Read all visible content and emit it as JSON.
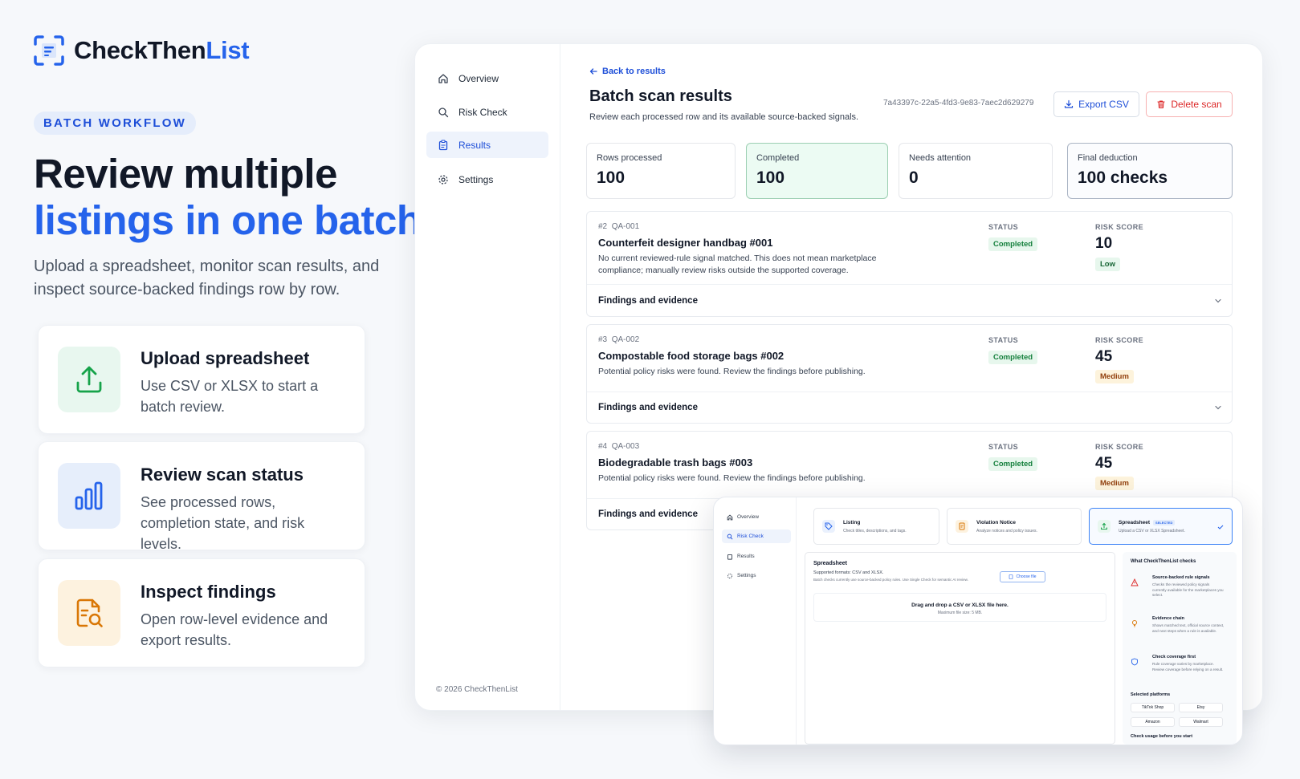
{
  "brand": {
    "name_part1": "CheckThen",
    "name_part2": "List",
    "accent": "#2563eb"
  },
  "hero": {
    "badge": "BATCH WORKFLOW",
    "title_line1": "Review multiple",
    "title_line2": "listings in one batch",
    "subtitle": "Upload a spreadsheet, monitor scan results, and inspect source-backed findings row by row."
  },
  "features": [
    {
      "title": "Upload spreadsheet",
      "desc": "Use CSV or XLSX to start a batch review.",
      "icon": "upload-icon"
    },
    {
      "title": "Review scan status",
      "desc": "See processed rows, completion state, and risk levels.",
      "icon": "bar-chart-icon"
    },
    {
      "title": "Inspect findings",
      "desc": "Open row-level evidence and export results.",
      "icon": "document-search-icon"
    }
  ],
  "app": {
    "nav": [
      {
        "label": "Overview",
        "icon": "home-icon"
      },
      {
        "label": "Risk Check",
        "icon": "search-icon"
      },
      {
        "label": "Results",
        "icon": "clipboard-icon",
        "active": true
      },
      {
        "label": "Settings",
        "icon": "gear-icon"
      }
    ],
    "footer": "© 2026 CheckThenList",
    "back_label": "Back to results",
    "page_title": "Batch scan results",
    "page_subtitle": "Review each processed row and its available source-backed signals.",
    "batch_id": "7a43397c-22a5-4fd3-9e83-7aec2d629279",
    "export_label": "Export CSV",
    "delete_label": "Delete scan",
    "stats": [
      {
        "label": "Rows processed",
        "value": "100"
      },
      {
        "label": "Completed",
        "value": "100"
      },
      {
        "label": "Needs attention",
        "value": "0"
      },
      {
        "label": "Final deduction",
        "value": "100 checks"
      }
    ],
    "status_header": "STATUS",
    "risk_header": "RISK SCORE",
    "findings_label": "Findings and evidence",
    "rows": [
      {
        "num": "#2",
        "code": "QA-001",
        "title": "Counterfeit designer handbag #001",
        "desc": "No current reviewed-rule signal matched. This does not mean marketplace compliance; manually review risks outside the supported coverage.",
        "status": "Completed",
        "score": "10",
        "level": "Low"
      },
      {
        "num": "#3",
        "code": "QA-002",
        "title": "Compostable food storage bags #002",
        "desc": "Potential policy risks were found. Review the findings before publishing.",
        "status": "Completed",
        "score": "45",
        "level": "Medium"
      },
      {
        "num": "#4",
        "code": "QA-003",
        "title": "Biodegradable trash bags #003",
        "desc": "Potential policy risks were found. Review the findings before publishing.",
        "status": "Completed",
        "score": "45",
        "level": "Medium"
      }
    ]
  },
  "overlay": {
    "nav": [
      "Overview",
      "Risk Check",
      "Results",
      "Settings"
    ],
    "modes": [
      {
        "title": "Listing",
        "desc": "Check titles, descriptions, and tags."
      },
      {
        "title": "Violation Notice",
        "desc": "Analyze notices and policy issues."
      },
      {
        "title": "Spreadsheet",
        "desc": "Upload a CSV or XLSX Spreadsheet.",
        "badge": "SELECTED"
      }
    ],
    "upload": {
      "title": "Spreadsheet",
      "formats": "Supported formats: CSV and XLSX.",
      "note": "Batch checks currently use source-backed policy rules. Use Single Check for semantic AI review.",
      "choose_label": "Choose file",
      "drop_text": "Drag and drop a CSV or XLSX file here.",
      "max_size": "Maximum file size: 5 MB."
    },
    "info": {
      "heading": "What CheckThenList checks",
      "items": [
        {
          "title": "Source-backed rule signals",
          "desc": "Checks the reviewed policy signals currently available for the marketplaces you select."
        },
        {
          "title": "Evidence chain",
          "desc": "Shows matched text, official source context, and next steps when a rule is available."
        },
        {
          "title": "Check coverage first",
          "desc": "Rule coverage varies by marketplace. Review coverage before relying on a result."
        }
      ],
      "platforms_heading": "Selected platforms",
      "platforms": [
        "TikTok Shop",
        "Etsy",
        "Amazon",
        "Walmart"
      ],
      "usage_heading": "Check usage before you start"
    }
  }
}
